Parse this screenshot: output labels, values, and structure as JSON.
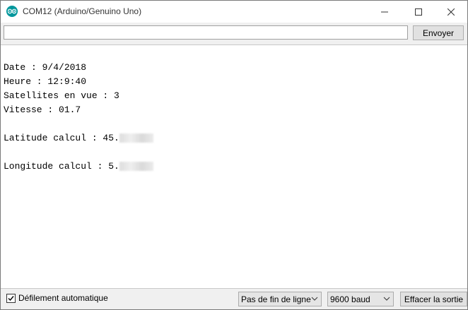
{
  "window": {
    "title": "COM12 (Arduino/Genuino Uno)",
    "icon": "arduino-logo-icon"
  },
  "controls": {
    "minimize_icon": "minimize-icon",
    "maximize_icon": "maximize-icon",
    "close_icon": "close-icon"
  },
  "send": {
    "input_value": "",
    "button_label": "Envoyer"
  },
  "output": {
    "lines": [
      "",
      "Date : 9/4/2018",
      "Heure : 12:9:40",
      "Satellites en vue : 3",
      "Vitesse : 01.7",
      "",
      "Latitude calcul : 45.",
      "",
      "Longitude calcul : 5."
    ],
    "redacted_note": "digits after decimal point are blurred"
  },
  "footer": {
    "autoscroll_label": "Défilement automatique",
    "autoscroll_checked": true,
    "line_ending": "Pas de fin de ligne",
    "baud_rate": "9600 baud",
    "clear_label": "Effacer la sortie"
  },
  "colors": {
    "accent": "#00979c",
    "window_bg": "#f0f0f0",
    "button_bg": "#e1e1e1"
  }
}
